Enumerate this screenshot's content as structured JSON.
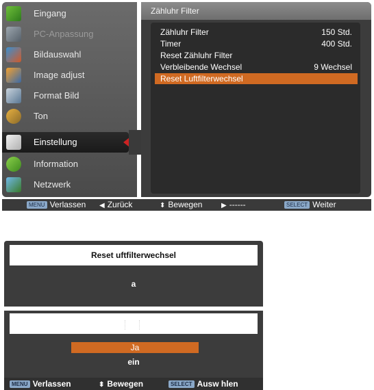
{
  "sidebar": {
    "items": [
      {
        "label": "Eingang",
        "icon": "input-icon",
        "state": "normal"
      },
      {
        "label": "PC-Anpassung",
        "icon": "pc-adjust-icon",
        "state": "disabled"
      },
      {
        "label": "Bildauswahl",
        "icon": "image-select-icon",
        "state": "normal"
      },
      {
        "label": "Image adjust",
        "icon": "image-adjust-icon",
        "state": "normal"
      },
      {
        "label": "Format Bild",
        "icon": "screen-format-icon",
        "state": "normal"
      },
      {
        "label": "Ton",
        "icon": "sound-icon",
        "state": "normal"
      },
      {
        "label": "Einstellung",
        "icon": "settings-tools-icon",
        "state": "active"
      },
      {
        "label": "Information",
        "icon": "information-icon",
        "state": "normal"
      },
      {
        "label": "Netzwerk",
        "icon": "network-icon",
        "state": "normal"
      }
    ]
  },
  "panel": {
    "title": "Zähluhr Filter",
    "rows": [
      {
        "label": "Zähluhr Filter",
        "value": "150 Std."
      },
      {
        "label": "Timer",
        "value": "400 Std."
      },
      {
        "label": "Reset Zähluhr Filter",
        "value": ""
      },
      {
        "label": "Verbleibende Wechsel",
        "value": "9 Wechsel"
      },
      {
        "label": "Reset Luftfilterwechsel",
        "value": "",
        "selected": true
      }
    ]
  },
  "statusbar": {
    "exit_key": "MENU",
    "exit_label": "Verlassen",
    "back_label": "Zurück",
    "move_label": "Bewegen",
    "dots": "------",
    "select_key": "SELECT",
    "next_label": "Weiter"
  },
  "dialog": {
    "title": "Reset uftfilterwechsel",
    "message": "a",
    "yes_label": "Ja",
    "no_label": "ein",
    "footer": {
      "exit_key": "MENU",
      "exit_label": "Verlassen",
      "move_label": "Bewegen",
      "select_key": "SELECT",
      "select_label": "Ausw hlen"
    }
  },
  "colors": {
    "highlight": "#d06a22",
    "active_arrow": "#cc2222",
    "panel_bg": "#3c3c3c"
  }
}
